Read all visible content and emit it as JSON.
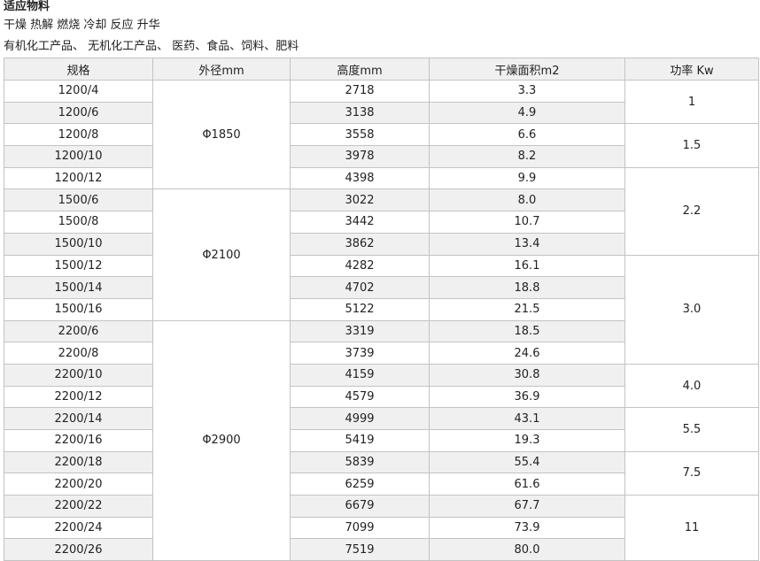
{
  "header": {
    "title": "适应物料",
    "line1": "干燥 热解 燃烧 冷却 反应 升华",
    "line2": "有机化工产品、 无机化工产品、 医药、食品、饲料、肥料"
  },
  "table": {
    "columns": [
      "规格",
      "外径mm",
      "高度mm",
      "干燥面积m2",
      "功率 Kw"
    ],
    "rows": [
      {
        "spec": "1200/4",
        "height": "2718",
        "area": "3.3"
      },
      {
        "spec": "1200/6",
        "height": "3138",
        "area": "4.9"
      },
      {
        "spec": "1200/8",
        "height": "3558",
        "area": "6.6"
      },
      {
        "spec": "1200/10",
        "height": "3978",
        "area": "8.2"
      },
      {
        "spec": "1200/12",
        "height": "4398",
        "area": "9.9"
      },
      {
        "spec": "1500/6",
        "height": "3022",
        "area": "8.0"
      },
      {
        "spec": "1500/8",
        "height": "3442",
        "area": "10.7"
      },
      {
        "spec": "1500/10",
        "height": "3862",
        "area": "13.4"
      },
      {
        "spec": "1500/12",
        "height": "4282",
        "area": "16.1"
      },
      {
        "spec": "1500/14",
        "height": "4702",
        "area": "18.8"
      },
      {
        "spec": "1500/16",
        "height": "5122",
        "area": "21.5"
      },
      {
        "spec": "2200/6",
        "height": "3319",
        "area": "18.5"
      },
      {
        "spec": "2200/8",
        "height": "3739",
        "area": "24.6"
      },
      {
        "spec": "2200/10",
        "height": "4159",
        "area": "30.8"
      },
      {
        "spec": "2200/12",
        "height": "4579",
        "area": "36.9"
      },
      {
        "spec": "2200/14",
        "height": "4999",
        "area": "43.1"
      },
      {
        "spec": "2200/16",
        "height": "5419",
        "area": "19.3"
      },
      {
        "spec": "2200/18",
        "height": "5839",
        "area": "55.4"
      },
      {
        "spec": "2200/20",
        "height": "6259",
        "area": "61.6"
      },
      {
        "spec": "2200/22",
        "height": "6679",
        "area": "67.7"
      },
      {
        "spec": "2200/24",
        "height": "7099",
        "area": "73.9"
      },
      {
        "spec": "2200/26",
        "height": "7519",
        "area": "80.0"
      }
    ],
    "diameter_groups": [
      "Φ1850",
      "Φ2100",
      "Φ2900"
    ],
    "power_groups": [
      "1",
      "1.5",
      "2.2",
      "3.0",
      "4.0",
      "5.5",
      "7.5",
      "11"
    ]
  }
}
